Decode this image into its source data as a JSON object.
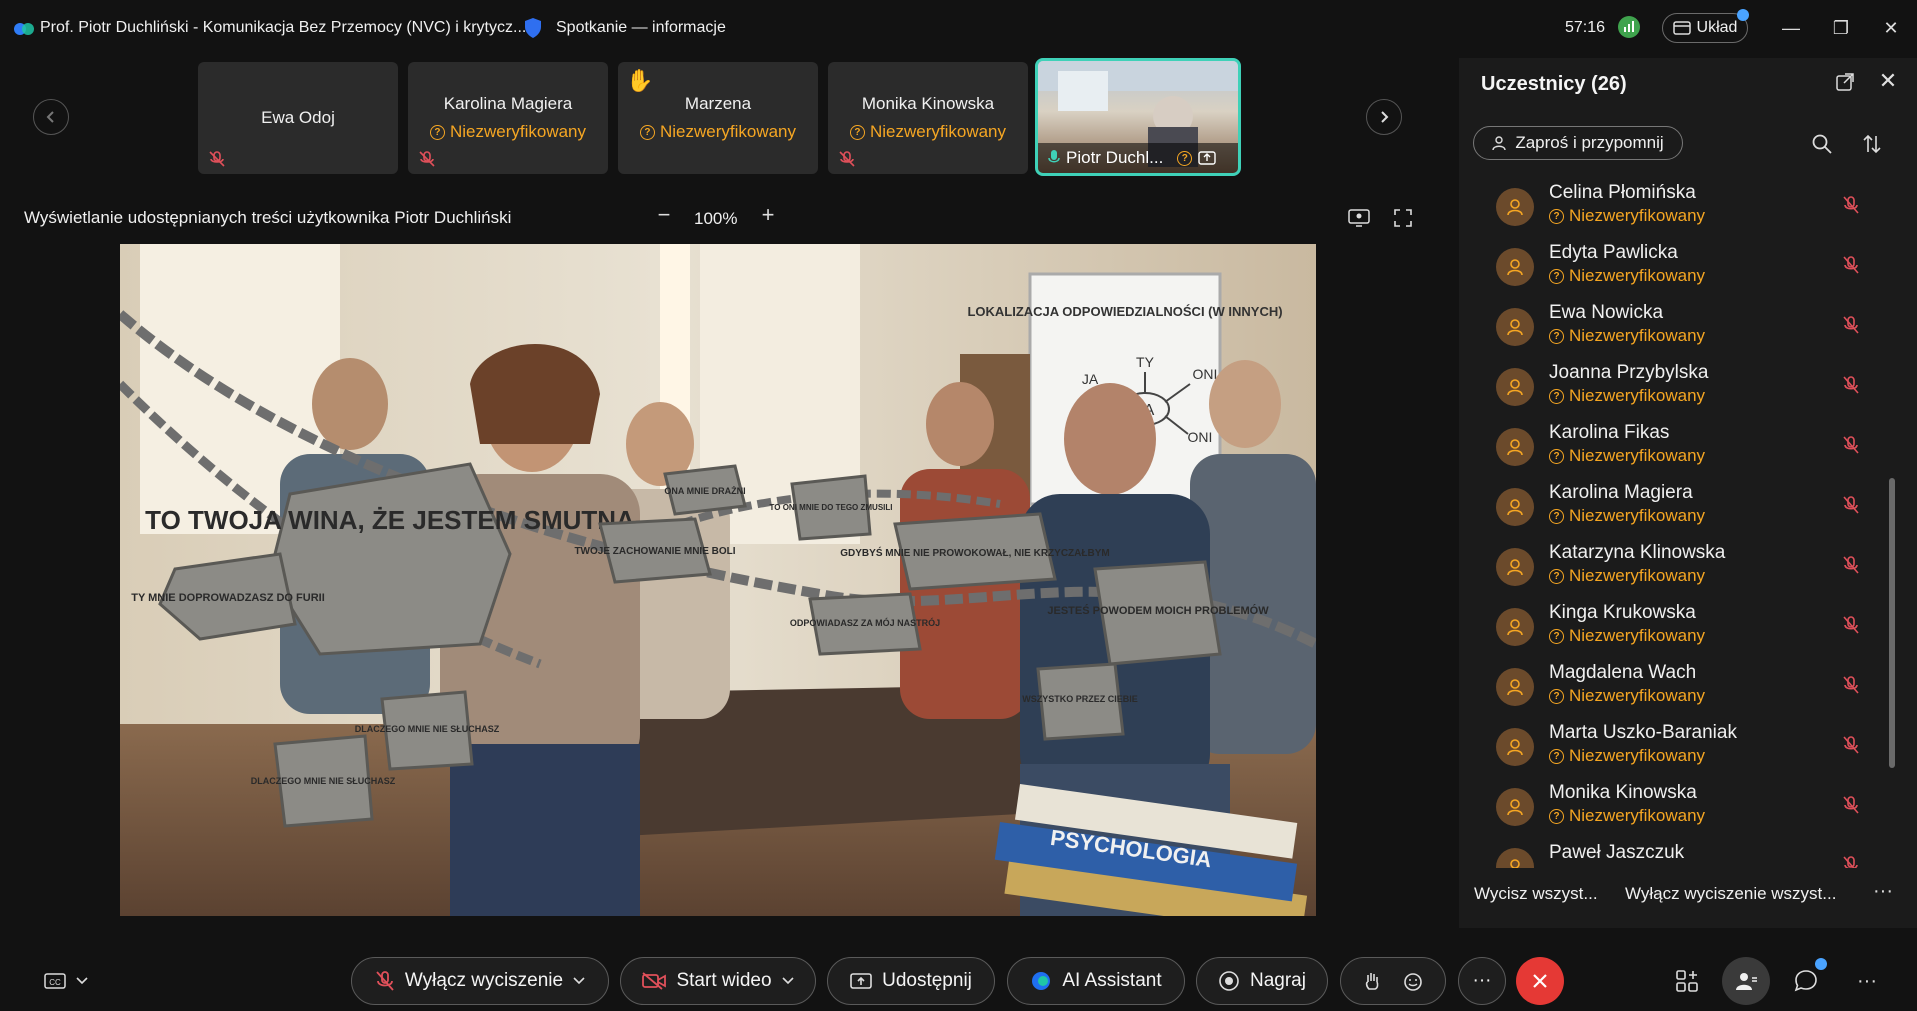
{
  "titlebar": {
    "app_title": "Prof. Piotr Duchliński - Komunikacja Bez Przemocy (NVC) i krytycz...",
    "meeting_info": "Spotkanie — informacje",
    "timer": "57:16",
    "layout_label": "Układ"
  },
  "video_strip": {
    "tiles": [
      {
        "name": "Ewa Odoj",
        "status": ""
      },
      {
        "name": "Karolina Magiera",
        "status": "Niezweryfikowany"
      },
      {
        "name": "Marzena",
        "status": "Niezweryfikowany"
      },
      {
        "name": "Monika Kinowska",
        "status": "Niezweryfikowany"
      }
    ],
    "active_tile_name": "Piotr Duchl..."
  },
  "share": {
    "title": "Wyświetlanie udostępnianych treści użytkownika Piotr Duchliński",
    "zoom_level": "100%",
    "zoom_out": "−",
    "zoom_in": "+"
  },
  "image_text": {
    "board_title": "LOKALIZACJA ODPOWIEDZIALNOŚCI (W INNYCH)",
    "board_center": "JA",
    "board_ty": "TY",
    "board_ja": "JA",
    "board_oni_1": "ONI",
    "board_oni_2": "ONI",
    "stone_1": "TO TWOJA WINA, ŻE JESTEM SMUTNA",
    "stone_2": "TY MNIE DOPROWADZASZ DO FURII",
    "stone_3": "TWOJE ZACHOWANIE MNIE BOLI",
    "stone_4": "ONA MNIE DRAŻNI",
    "stone_5": "TO ONI MNIE DO TEGO ZMUSILI",
    "stone_6": "GDYBYŚ MNIE NIE PROWOKOWAŁ, NIE KRZYCZAŁBYM",
    "stone_7": "ODPOWIADASZ ZA MÓJ NASTRÓJ",
    "stone_8": "JESTEŚ POWODEM MOICH PROBLEMÓW",
    "stone_9": "WSZYSTKO PRZEZ CIEBIE",
    "stone_10": "DLACZEGO MNIE NIE SŁUCHASZ",
    "stone_11": "DLACZEGO MNIE NIE SŁUCHASZ",
    "book": "PSYCHOLOGIA"
  },
  "participants": {
    "title": "Uczestnicy (26)",
    "invite_label": "Zaproś i przypomnij",
    "list": [
      {
        "name": "Celina Płomińska",
        "status": "Niezweryfikowany"
      },
      {
        "name": "Edyta Pawlicka",
        "status": "Niezweryfikowany"
      },
      {
        "name": "Ewa Nowicka",
        "status": "Niezweryfikowany"
      },
      {
        "name": "Joanna Przybylska",
        "status": "Niezweryfikowany"
      },
      {
        "name": "Karolina Fikas",
        "status": "Niezweryfikowany"
      },
      {
        "name": "Karolina Magiera",
        "status": "Niezweryfikowany"
      },
      {
        "name": "Katarzyna Klinowska",
        "status": "Niezweryfikowany"
      },
      {
        "name": "Kinga Krukowska",
        "status": "Niezweryfikowany"
      },
      {
        "name": "Magdalena Wach",
        "status": "Niezweryfikowany"
      },
      {
        "name": "Marta Uszko-Baraniak",
        "status": "Niezweryfikowany"
      },
      {
        "name": "Monika Kinowska",
        "status": "Niezweryfikowany"
      },
      {
        "name": "Paweł Jaszczuk",
        "status": ""
      }
    ],
    "mute_all": "Wycisz wszyst...",
    "unmute_all": "Wyłącz wyciszenie wszyst..."
  },
  "toolbar": {
    "unmute_label": "Wyłącz wyciszenie",
    "video_label": "Start wideo",
    "share_label": "Udostępnij",
    "ai_label": "AI Assistant",
    "record_label": "Nagraj",
    "more_label": "···"
  },
  "colors": {
    "accent_teal": "#3fd1b8",
    "warning_orange": "#f5a623",
    "mute_red": "#e0505a",
    "end_call_red": "#e53935",
    "notification_blue": "#4aa3ff"
  }
}
